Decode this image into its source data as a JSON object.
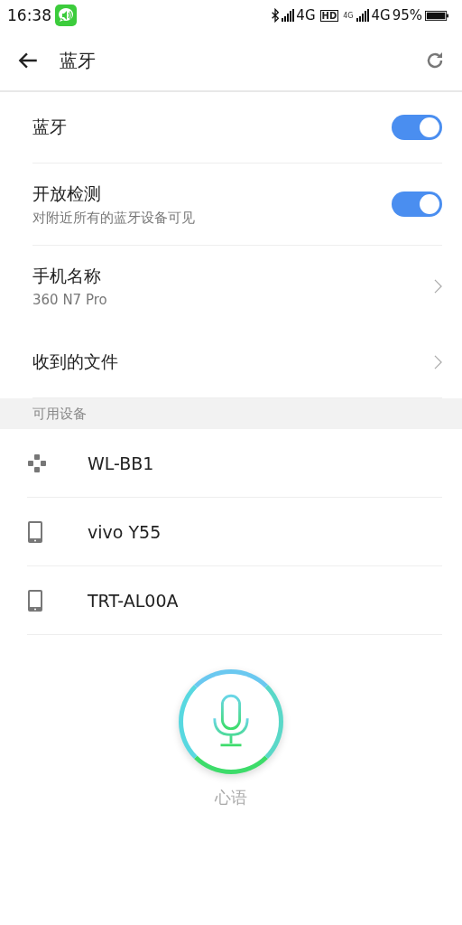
{
  "status_bar": {
    "time": "16:38",
    "network_1": "4G",
    "hd_badge": "HD",
    "network_2_small": "4G",
    "network_2": "4G",
    "battery": "95%"
  },
  "header": {
    "title": "蓝牙"
  },
  "settings": [
    {
      "kind": "toggle",
      "label": "蓝牙",
      "on": true
    },
    {
      "kind": "toggle",
      "label": "开放检测",
      "sublabel": "对附近所有的蓝牙设备可见",
      "on": true
    },
    {
      "kind": "nav",
      "label": "手机名称",
      "sublabel": "360 N7 Pro"
    },
    {
      "kind": "nav",
      "label": "收到的文件"
    }
  ],
  "section_header": "可用设备",
  "devices": [
    {
      "kind": "gamepad",
      "name": "WL-BB1"
    },
    {
      "kind": "phone",
      "name": "vivo Y55"
    },
    {
      "kind": "phone",
      "name": "TRT-AL00A"
    }
  ],
  "voice_assistant": {
    "label": "心语"
  }
}
